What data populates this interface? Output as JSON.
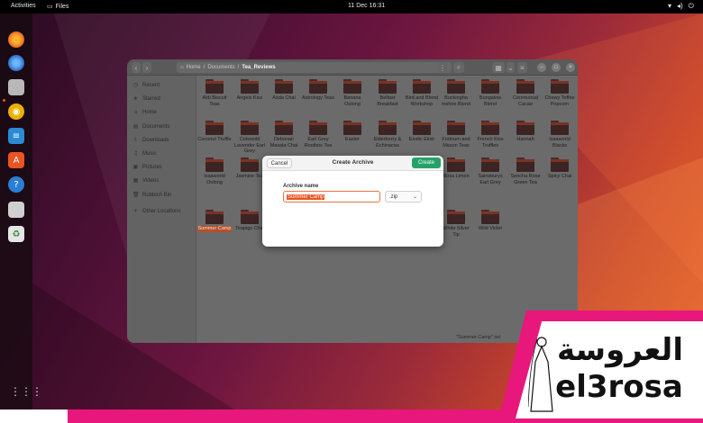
{
  "topbar": {
    "activities": "Activities",
    "app_name": "Files",
    "clock": "11 Dec  16:31",
    "tray_icons": [
      "network-icon",
      "volume-icon",
      "power-icon"
    ]
  },
  "dock": {
    "icons": [
      "firefox-icon",
      "thunderbird-icon",
      "files-icon",
      "rhythmbox-icon",
      "writer-icon",
      "software-icon",
      "help-icon",
      "drive-icon",
      "trash-icon",
      "apps-grid-icon"
    ]
  },
  "window": {
    "path": {
      "home": "Home",
      "documents": "Documents",
      "current": "Tea_Reviews"
    }
  },
  "sidebar": {
    "items": [
      {
        "icon": "clock-icon",
        "label": "Recent"
      },
      {
        "icon": "star-icon",
        "label": "Starred"
      },
      {
        "icon": "home-icon",
        "label": "Home"
      },
      {
        "icon": "document-icon",
        "label": "Documents"
      },
      {
        "icon": "download-icon",
        "label": "Downloads"
      },
      {
        "icon": "music-icon",
        "label": "Music"
      },
      {
        "icon": "pictures-icon",
        "label": "Pictures"
      },
      {
        "icon": "video-icon",
        "label": "Videos"
      },
      {
        "icon": "trash-icon",
        "label": "Rubbish Bin"
      },
      {
        "icon": "plus-icon",
        "label": "Other Locations"
      }
    ]
  },
  "files": [
    {
      "label": "Aldi Biscuit Teas"
    },
    {
      "label": "Angels Kiss"
    },
    {
      "label": "Asda Chai"
    },
    {
      "label": "Astrology Teas"
    },
    {
      "label": "Banana Oolong"
    },
    {
      "label": "Belfast Breakfast"
    },
    {
      "label": "Bird and Blend Workshop"
    },
    {
      "label": "Buckingha mshire Blend"
    },
    {
      "label": "Bungalow Blend"
    },
    {
      "label": "Ceremonial Cacao"
    },
    {
      "label": "Chewy Toffee Popcorn"
    },
    {
      "label": "Coconut Truffle"
    },
    {
      "label": "Cotswold Lavender Earl Grey"
    },
    {
      "label": "Debonair Masala Chai"
    },
    {
      "label": "Earl Grey Rooibos Tea"
    },
    {
      "label": "Easter"
    },
    {
      "label": "Elderberry & Echinacea"
    },
    {
      "label": "Exotic Elixir"
    },
    {
      "label": "Fortnum and Mason Teas"
    },
    {
      "label": "French Kiss Truffles"
    },
    {
      "label": "Hannah"
    },
    {
      "label": "Isaaworld Blacks"
    },
    {
      "label": "Isaaworld Oolong"
    },
    {
      "label": "Jasmine Tea"
    },
    {
      "label": "Rosa Limon"
    },
    {
      "label": "Sainsburys Earl Grey"
    },
    {
      "label": "Sencha Rose Green Tea"
    },
    {
      "label": "Spicy Chai"
    },
    {
      "label": "Summer Camp"
    },
    {
      "label": "Teapigs Chai"
    },
    {
      "label": "White Silver Tip"
    },
    {
      "label": "Wild Violet"
    }
  ],
  "notification": "\"Summer Camp\" sel",
  "dialog": {
    "cancel": "Cancel",
    "title": "Create Archive",
    "create": "Create",
    "name_label": "Archive name",
    "name_value": "Summer Camp",
    "format": ".zip"
  },
  "watermark": {
    "arabic": "العروسة",
    "latin": "el3rosa"
  },
  "colors": {
    "accent": "#e95420",
    "create_button": "#26a269",
    "watermark_pink": "#e8177c"
  }
}
